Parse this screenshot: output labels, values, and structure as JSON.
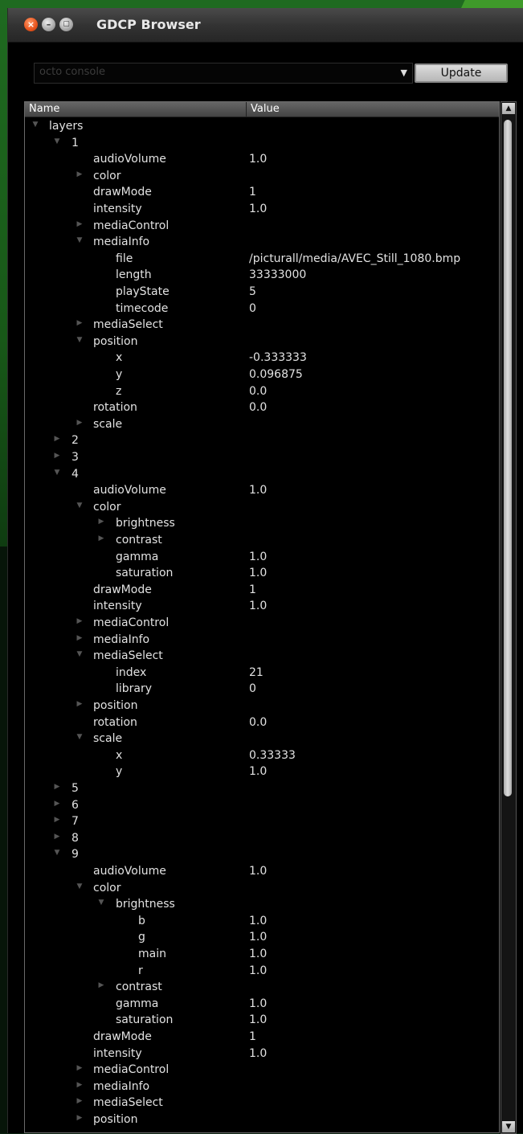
{
  "window": {
    "title": "GDCP Browser"
  },
  "toolbar": {
    "connection_value": "octo console",
    "update_label": "Update"
  },
  "tree": {
    "columns": [
      "Name",
      "Value"
    ],
    "rows": [
      {
        "name": "layers",
        "value": "",
        "depth": 0,
        "expander": "open"
      },
      {
        "name": "1",
        "value": "",
        "depth": 1,
        "expander": "open"
      },
      {
        "name": "audioVolume",
        "value": "1.0",
        "depth": 2,
        "expander": "none"
      },
      {
        "name": "color",
        "value": "",
        "depth": 2,
        "expander": "closed"
      },
      {
        "name": "drawMode",
        "value": "1",
        "depth": 2,
        "expander": "none"
      },
      {
        "name": "intensity",
        "value": "1.0",
        "depth": 2,
        "expander": "none"
      },
      {
        "name": "mediaControl",
        "value": "",
        "depth": 2,
        "expander": "closed"
      },
      {
        "name": "mediaInfo",
        "value": "",
        "depth": 2,
        "expander": "open"
      },
      {
        "name": "file",
        "value": "/picturall/media/AVEC_Still_1080.bmp",
        "depth": 3,
        "expander": "none"
      },
      {
        "name": "length",
        "value": "33333000",
        "depth": 3,
        "expander": "none"
      },
      {
        "name": "playState",
        "value": "5",
        "depth": 3,
        "expander": "none"
      },
      {
        "name": "timecode",
        "value": "0",
        "depth": 3,
        "expander": "none"
      },
      {
        "name": "mediaSelect",
        "value": "",
        "depth": 2,
        "expander": "closed"
      },
      {
        "name": "position",
        "value": "",
        "depth": 2,
        "expander": "open"
      },
      {
        "name": "x",
        "value": "-0.333333",
        "depth": 3,
        "expander": "none"
      },
      {
        "name": "y",
        "value": "0.096875",
        "depth": 3,
        "expander": "none"
      },
      {
        "name": "z",
        "value": "0.0",
        "depth": 3,
        "expander": "none"
      },
      {
        "name": "rotation",
        "value": "0.0",
        "depth": 2,
        "expander": "none"
      },
      {
        "name": "scale",
        "value": "",
        "depth": 2,
        "expander": "closed"
      },
      {
        "name": "2",
        "value": "",
        "depth": 1,
        "expander": "closed"
      },
      {
        "name": "3",
        "value": "",
        "depth": 1,
        "expander": "closed"
      },
      {
        "name": "4",
        "value": "",
        "depth": 1,
        "expander": "open"
      },
      {
        "name": "audioVolume",
        "value": "1.0",
        "depth": 2,
        "expander": "none"
      },
      {
        "name": "color",
        "value": "",
        "depth": 2,
        "expander": "open"
      },
      {
        "name": "brightness",
        "value": "",
        "depth": 3,
        "expander": "closed"
      },
      {
        "name": "contrast",
        "value": "",
        "depth": 3,
        "expander": "closed"
      },
      {
        "name": "gamma",
        "value": "1.0",
        "depth": 3,
        "expander": "none"
      },
      {
        "name": "saturation",
        "value": "1.0",
        "depth": 3,
        "expander": "none"
      },
      {
        "name": "drawMode",
        "value": "1",
        "depth": 2,
        "expander": "none"
      },
      {
        "name": "intensity",
        "value": "1.0",
        "depth": 2,
        "expander": "none"
      },
      {
        "name": "mediaControl",
        "value": "",
        "depth": 2,
        "expander": "closed"
      },
      {
        "name": "mediaInfo",
        "value": "",
        "depth": 2,
        "expander": "closed"
      },
      {
        "name": "mediaSelect",
        "value": "",
        "depth": 2,
        "expander": "open"
      },
      {
        "name": "index",
        "value": "21",
        "depth": 3,
        "expander": "none"
      },
      {
        "name": "library",
        "value": "0",
        "depth": 3,
        "expander": "none"
      },
      {
        "name": "position",
        "value": "",
        "depth": 2,
        "expander": "closed"
      },
      {
        "name": "rotation",
        "value": "0.0",
        "depth": 2,
        "expander": "none"
      },
      {
        "name": "scale",
        "value": "",
        "depth": 2,
        "expander": "open"
      },
      {
        "name": "x",
        "value": "0.33333",
        "depth": 3,
        "expander": "none"
      },
      {
        "name": "y",
        "value": "1.0",
        "depth": 3,
        "expander": "none"
      },
      {
        "name": "5",
        "value": "",
        "depth": 1,
        "expander": "closed"
      },
      {
        "name": "6",
        "value": "",
        "depth": 1,
        "expander": "closed"
      },
      {
        "name": "7",
        "value": "",
        "depth": 1,
        "expander": "closed"
      },
      {
        "name": "8",
        "value": "",
        "depth": 1,
        "expander": "closed"
      },
      {
        "name": "9",
        "value": "",
        "depth": 1,
        "expander": "open"
      },
      {
        "name": "audioVolume",
        "value": "1.0",
        "depth": 2,
        "expander": "none"
      },
      {
        "name": "color",
        "value": "",
        "depth": 2,
        "expander": "open"
      },
      {
        "name": "brightness",
        "value": "",
        "depth": 3,
        "expander": "open"
      },
      {
        "name": "b",
        "value": "1.0",
        "depth": 4,
        "expander": "none"
      },
      {
        "name": "g",
        "value": "1.0",
        "depth": 4,
        "expander": "none"
      },
      {
        "name": "main",
        "value": "1.0",
        "depth": 4,
        "expander": "none"
      },
      {
        "name": "r",
        "value": "1.0",
        "depth": 4,
        "expander": "none"
      },
      {
        "name": "contrast",
        "value": "",
        "depth": 3,
        "expander": "closed"
      },
      {
        "name": "gamma",
        "value": "1.0",
        "depth": 3,
        "expander": "none"
      },
      {
        "name": "saturation",
        "value": "1.0",
        "depth": 3,
        "expander": "none"
      },
      {
        "name": "drawMode",
        "value": "1",
        "depth": 2,
        "expander": "none"
      },
      {
        "name": "intensity",
        "value": "1.0",
        "depth": 2,
        "expander": "none"
      },
      {
        "name": "mediaControl",
        "value": "",
        "depth": 2,
        "expander": "closed"
      },
      {
        "name": "mediaInfo",
        "value": "",
        "depth": 2,
        "expander": "closed"
      },
      {
        "name": "mediaSelect",
        "value": "",
        "depth": 2,
        "expander": "closed"
      },
      {
        "name": "position",
        "value": "",
        "depth": 2,
        "expander": "closed"
      }
    ]
  }
}
